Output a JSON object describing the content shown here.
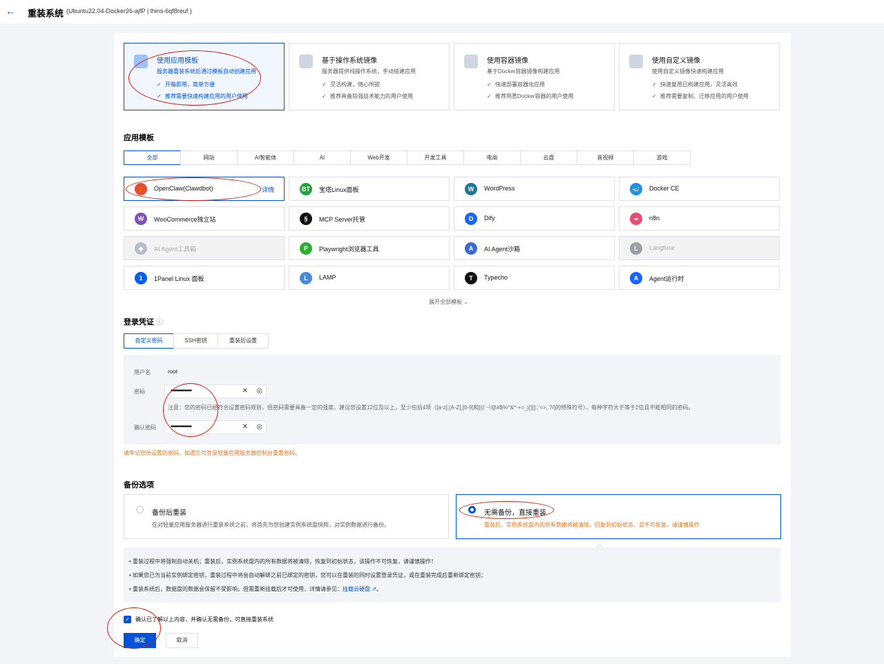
{
  "header": {
    "back_icon": "arrow-left-icon",
    "title": "重装系统",
    "subtitle": "(Ubuntu22.04-Docker26-ajfP | lhins-6qf8reuf )"
  },
  "modes": [
    {
      "title": "使用应用模板",
      "desc": "服务器重装系统后通过模板自动创建应用",
      "features": [
        "开箱即用，简单方便",
        "推荐需要快速构建应用的用户使用"
      ],
      "active": true
    },
    {
      "title": "基于操作系统镜像",
      "desc": "服务器提供纯操作系统，手动搭建应用",
      "features": [
        "灵活构建，随心所欲",
        "推荐具备较强技术能力的用户使用"
      ]
    },
    {
      "title": "使用容器镜像",
      "desc": "基于Docker容器镜像构建应用",
      "features": [
        "快速部署容器化应用",
        "推荐熟悉Docker容器的用户使用"
      ]
    },
    {
      "title": "使用自定义镜像",
      "desc": "使用自定义镜像快速构建应用",
      "features": [
        "快速复用已构建应用，灵活高效",
        "推荐需要复制、迁移应用的用户使用"
      ]
    }
  ],
  "check_mark": "✓",
  "templates_section": {
    "title": "应用模板",
    "categories": [
      "全部",
      "网站",
      "AI智能体",
      "AI",
      "Web开发",
      "开发工具",
      "电商",
      "云盘",
      "音视频",
      "游戏"
    ],
    "items": [
      {
        "name": "OpenClaw(Clawdbot)",
        "detail": "详情",
        "color": "#e34d3b",
        "glyph": "🦀"
      },
      {
        "name": "宝塔Linux面板",
        "color": "#20a53a",
        "glyph": "BT"
      },
      {
        "name": "WordPress",
        "color": "#21759b",
        "glyph": "W"
      },
      {
        "name": "Docker CE",
        "color": "#1d91e6",
        "glyph": "🐳"
      },
      {
        "name": "WooCommerce独立站",
        "color": "#7f54b3",
        "glyph": "W"
      },
      {
        "name": "MCP Server托管",
        "color": "#111111",
        "glyph": "§"
      },
      {
        "name": "Dify",
        "color": "#1c64f2",
        "glyph": "D"
      },
      {
        "name": "n8n",
        "color": "#ea4b71",
        "glyph": "∞"
      },
      {
        "name": "AI Agent工具箱",
        "color": "#b8bfc9",
        "glyph": "◆",
        "disabled": true
      },
      {
        "name": "Playwright浏览器工具",
        "color": "#2ead33",
        "glyph": "P"
      },
      {
        "name": "AI Agent沙箱",
        "color": "#3b6bd8",
        "glyph": "A"
      },
      {
        "name": "Langfuse",
        "color": "#9aa0a6",
        "glyph": "L",
        "disabled": true
      },
      {
        "name": "1Panel Linux 面板",
        "color": "#005eeb",
        "glyph": "1"
      },
      {
        "name": "LAMP",
        "color": "#4b8ad6",
        "glyph": "L"
      },
      {
        "name": "Typecho",
        "color": "#111111",
        "glyph": "T"
      },
      {
        "name": "Agent运行时",
        "color": "#1664ff",
        "glyph": "A"
      }
    ],
    "expand": "展开全部模板 ⌄"
  },
  "login": {
    "title": "登录凭证",
    "info_icon": "ⓘ",
    "tabs": [
      "自定义密码",
      "SSH密钥",
      "重装后设置"
    ],
    "username_label": "用户名",
    "username": "root",
    "password_label": "密码",
    "confirm_label": "确认密码",
    "password_mask": "••••••••••••",
    "note": "注意：您的密码已经符合设置密码规则，但密码需要具备一定的强度，建议您设置12位及以上，至少包括4项（[a-z],[A-Z],[0-9]和[()`~!@#$%^&*-+=_|{}[]:;'<>,.?/]的特殊符号），每种字符大于等于2位且不能相同的密码。",
    "warning": "请牢记您所设置的密码，如遗忘可登录轻量应用服务器控制台重置密码。"
  },
  "backup": {
    "title": "备份选项",
    "options": [
      {
        "title": "备份后重装",
        "desc": "在对轻量应用服务器进行重装系统之前，将首先为您创建实例系统盘快照，对实例数据进行备份。"
      },
      {
        "title": "无需备份，直接重装",
        "desc": "重装后，实例系统盘内的所有数据将被清除，回复到初始状态，且不可恢复，请谨慎操作",
        "active": true
      }
    ],
    "tips": [
      "• 重装过程中将强制自动关机；重装后，实例系统盘内的所有数据将被清除，恢复到初始状态，该操作不可恢复，请谨慎操作！",
      "• 如果您已为当前实例绑定密钥，重装过程中将会自动解绑之前已绑定的密钥，您可以在重装的同时设置登录凭证，或在重装完成后重新绑定密钥；",
      "• 重装系统后，数据盘的数据会保留不受影响，但需重新挂载后才可使用，详情请参见："
    ],
    "tip_link": "挂载云硬盘 ↗",
    "tip_link_suffix": "。"
  },
  "footer": {
    "confirm_text": "确认已了解以上内容，并确认无需备份，可直接重装系统",
    "ok": "确定",
    "cancel": "取消"
  },
  "colors": {
    "primary": "#0052d9",
    "warning": "#e37318",
    "annotation": "#d81e06"
  }
}
